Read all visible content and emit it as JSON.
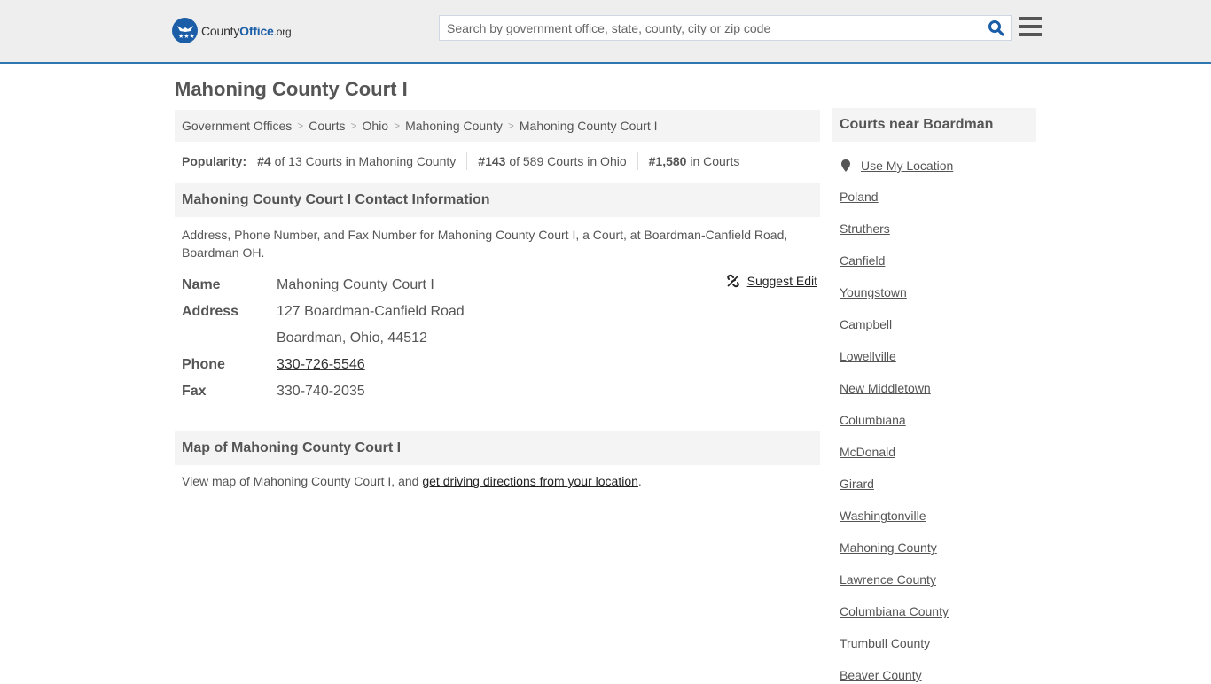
{
  "header": {
    "logo": {
      "county": "County",
      "office": "Office",
      "org": ".org"
    },
    "search": {
      "placeholder": "Search by government office, state, county, city or zip code",
      "value": ""
    },
    "colors": {
      "brand": "#1b5ea7",
      "border": "#2e77b1"
    }
  },
  "page": {
    "title": "Mahoning County Court I"
  },
  "breadcrumb": [
    {
      "label": "Government Offices"
    },
    {
      "label": "Courts"
    },
    {
      "label": "Ohio"
    },
    {
      "label": "Mahoning County"
    },
    {
      "label": "Mahoning County Court I"
    }
  ],
  "popularity": {
    "label": "Popularity:",
    "items": [
      {
        "rank": "#4",
        "text": " of 13 Courts in Mahoning County"
      },
      {
        "rank": "#143",
        "text": " of 589 Courts in Ohio"
      },
      {
        "rank": "#1,580",
        "text": " in Courts"
      }
    ]
  },
  "contact": {
    "heading": "Mahoning County Court I Contact Information",
    "description": "Address, Phone Number, and Fax Number for Mahoning County Court I, a Court, at Boardman-Canfield Road, Boardman OH.",
    "suggest_edit": "Suggest Edit",
    "fields": {
      "name_label": "Name",
      "name": "Mahoning County Court I",
      "address_label": "Address",
      "address1": "127 Boardman-Canfield Road",
      "address2": "Boardman, Ohio, 44512",
      "phone_label": "Phone",
      "phone": "330-726-5546",
      "fax_label": "Fax",
      "fax": "330-740-2035"
    }
  },
  "map": {
    "heading": "Map of Mahoning County Court I",
    "desc_prefix": "View map of Mahoning County Court I, and ",
    "desc_link": "get driving directions from your location",
    "desc_suffix": "."
  },
  "sidebar": {
    "heading": "Courts near Boardman",
    "use_location": "Use My Location",
    "items": [
      "Poland",
      "Struthers",
      "Canfield",
      "Youngstown",
      "Campbell",
      "Lowellville",
      "New Middletown",
      "Columbiana",
      "McDonald",
      "Girard",
      "Washingtonville",
      "Mahoning County",
      "Lawrence County",
      "Columbiana County",
      "Trumbull County",
      "Beaver County"
    ]
  }
}
